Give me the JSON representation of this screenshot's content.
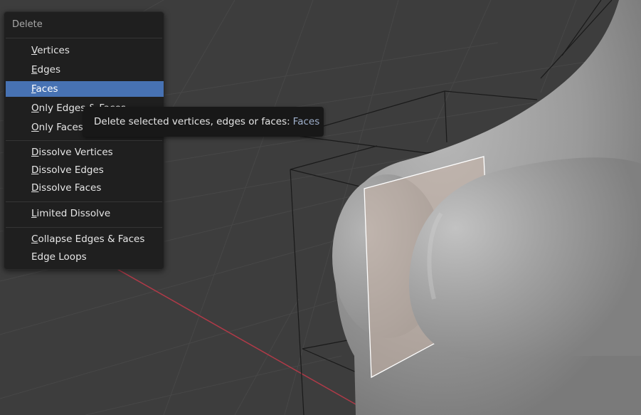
{
  "menu": {
    "title": "Delete",
    "items": [
      {
        "label": "Vertices",
        "underline": "V"
      },
      {
        "label": "Edges",
        "underline": "E"
      },
      {
        "label": "Faces",
        "underline": "F",
        "active": true
      },
      {
        "label": "Only Edges & Faces",
        "underline": "O"
      },
      {
        "label": "Only Faces",
        "underline": "O"
      },
      {
        "label": "Dissolve Vertices",
        "underline": "D"
      },
      {
        "label": "Dissolve Edges",
        "underline": "D"
      },
      {
        "label": "Dissolve Faces",
        "underline": "D"
      },
      {
        "label": "Limited Dissolve",
        "underline": "L"
      },
      {
        "label": "Collapse Edges & Faces",
        "underline": "C"
      },
      {
        "label": "Edge Loops",
        "underline": ""
      }
    ]
  },
  "tooltip": {
    "text": "Delete selected vertices, edges or faces:",
    "value": "Faces"
  },
  "colors": {
    "viewport_bg": "#3d3d3d",
    "menu_bg": "#1f1f1f",
    "highlight": "#4772b3",
    "tooltip_value": "#9fb0cc",
    "x_axis": "#b03a48"
  }
}
